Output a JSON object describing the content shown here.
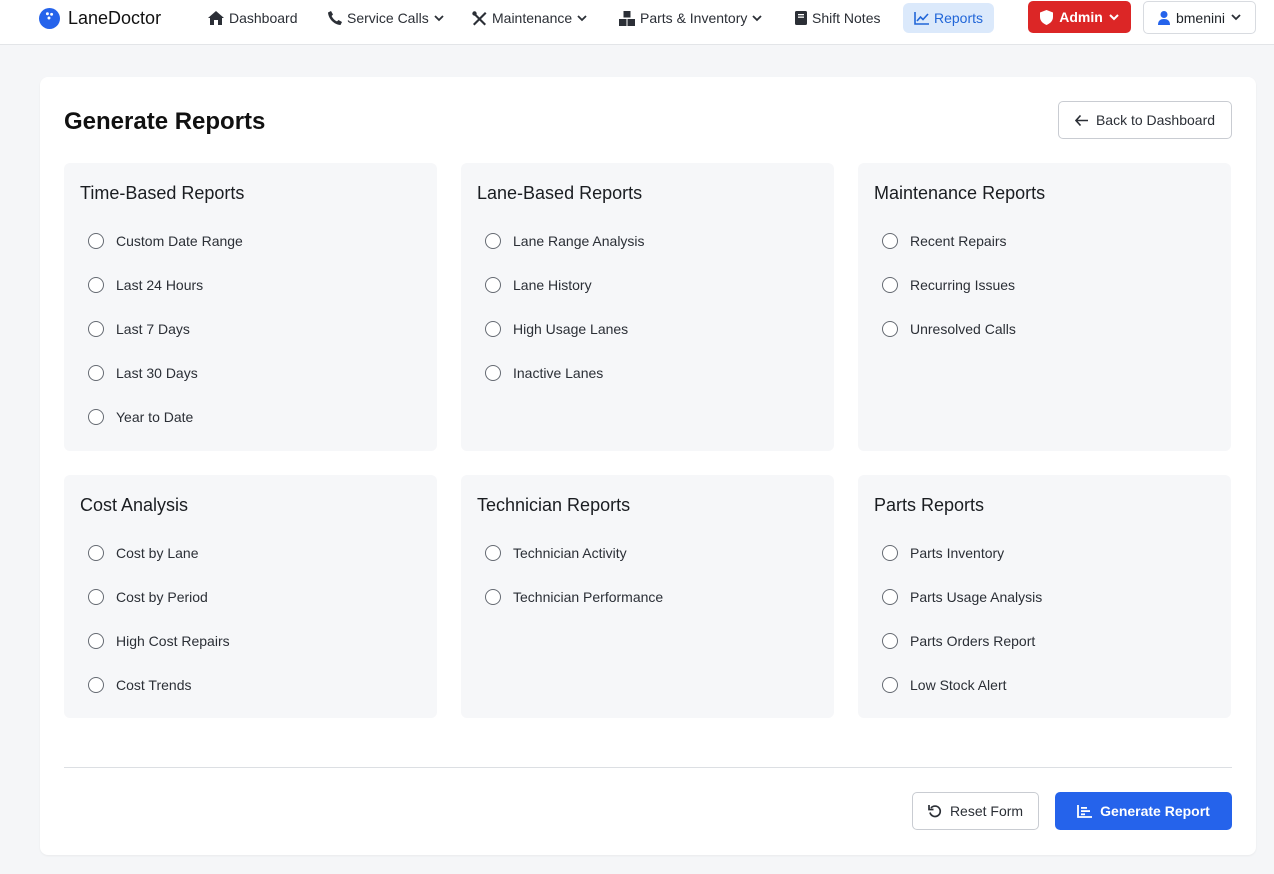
{
  "navbar": {
    "brand": "LaneDoctor",
    "items": [
      {
        "label": "Dashboard",
        "icon": "home-icon"
      },
      {
        "label": "Service Calls",
        "icon": "phone-icon",
        "dropdown": true
      },
      {
        "label": "Maintenance",
        "icon": "tools-icon",
        "dropdown": true
      },
      {
        "label": "Parts & Inventory",
        "icon": "boxes-icon",
        "dropdown": true
      },
      {
        "label": "Shift Notes",
        "icon": "book-icon"
      },
      {
        "label": "Reports",
        "icon": "chart-line-icon",
        "active": true
      }
    ],
    "admin_label": "Admin",
    "user_label": "bmenini"
  },
  "page": {
    "title": "Generate Reports",
    "back_label": "Back to Dashboard",
    "reset_label": "Reset Form",
    "generate_label": "Generate Report"
  },
  "sections": [
    {
      "title": "Time-Based Reports",
      "options": [
        "Custom Date Range",
        "Last 24 Hours",
        "Last 7 Days",
        "Last 30 Days",
        "Year to Date"
      ]
    },
    {
      "title": "Lane-Based Reports",
      "options": [
        "Lane Range Analysis",
        "Lane History",
        "High Usage Lanes",
        "Inactive Lanes"
      ]
    },
    {
      "title": "Maintenance Reports",
      "options": [
        "Recent Repairs",
        "Recurring Issues",
        "Unresolved Calls"
      ]
    },
    {
      "title": "Cost Analysis",
      "options": [
        "Cost by Lane",
        "Cost by Period",
        "High Cost Repairs",
        "Cost Trends"
      ]
    },
    {
      "title": "Technician Reports",
      "options": [
        "Technician Activity",
        "Technician Performance"
      ]
    },
    {
      "title": "Parts Reports",
      "options": [
        "Parts Inventory",
        "Parts Usage Analysis",
        "Parts Orders Report",
        "Low Stock Alert"
      ]
    }
  ],
  "colors": {
    "primary": "#2563eb",
    "danger": "#dc2626",
    "active_nav_bg": "#dbe9fb"
  }
}
